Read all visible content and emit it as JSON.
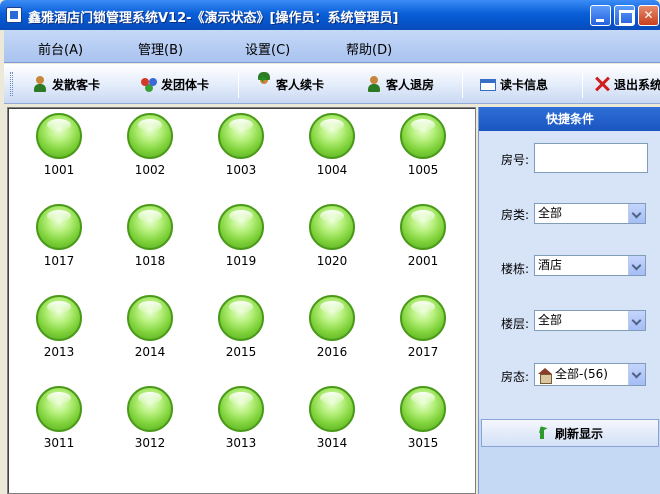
{
  "window": {
    "title": "鑫雅酒店门锁管理系统V12-《演示状态》[操作员：系统管理员]"
  },
  "menu": [
    {
      "label": "前台(A)"
    },
    {
      "label": "管理(B)"
    },
    {
      "label": "设置(C)"
    },
    {
      "label": "帮助(D)"
    }
  ],
  "toolbar": {
    "buttons": [
      {
        "label": "发散客卡",
        "icon": "guest-icon"
      },
      {
        "label": "发团体卡",
        "icon": "group-icon"
      },
      {
        "label": "客人续卡",
        "icon": "guest-renew-icon"
      },
      {
        "label": "客人退房",
        "icon": "checkout-icon"
      },
      {
        "label": "读卡信息",
        "icon": "card-reader-icon"
      },
      {
        "label": "退出系统",
        "icon": "exit-icon"
      }
    ]
  },
  "rooms": [
    "1001",
    "1002",
    "1003",
    "1004",
    "1005",
    "1017",
    "1018",
    "1019",
    "1020",
    "2001",
    "2013",
    "2014",
    "2015",
    "2016",
    "2017",
    "3011",
    "3012",
    "3013",
    "3014",
    "3015"
  ],
  "status_color": "#7fd23a",
  "filter": {
    "header": "快捷条件",
    "room_no_label": "房号:",
    "room_no_value": "",
    "room_type_label": "房类:",
    "room_type_value": "全部",
    "building_label": "楼栋:",
    "building_value": "酒店",
    "floor_label": "楼层:",
    "floor_value": "全部",
    "status_label": "房态:",
    "status_value": "全部-(56)",
    "refresh_label": "刷新显示"
  }
}
